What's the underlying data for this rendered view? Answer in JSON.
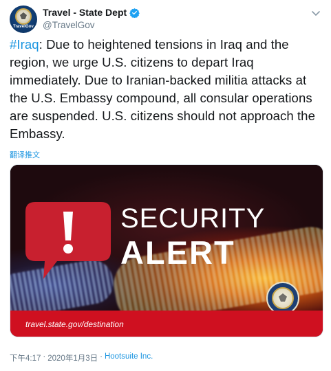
{
  "account": {
    "display_name": "Travel - State Dept",
    "handle": "@TravelGov",
    "avatar_caption": "TravelGov",
    "verified": true
  },
  "tweet": {
    "hashtag": "#Iraq",
    "text": ": Due to heightened tensions in Iraq and the region, we urge U.S. citizens to depart Iraq immediately. Due to Iranian-backed militia attacks at the U.S. Embassy compound, all consular operations are suspended. U.S. citizens should not approach the Embassy.",
    "translate_label": "翻译推文"
  },
  "media": {
    "line1": "SECURITY",
    "line2": "ALERT",
    "url": "travel.state.gov/destination",
    "colors": {
      "band": "#cf1020",
      "bubble": "#c8202f"
    }
  },
  "meta": {
    "time": "下午4:17",
    "separator": "·",
    "date": "2020年1月3日",
    "source": "Hootsuite Inc."
  },
  "icons": [
    "verified-badge-icon",
    "chevron-down-icon",
    "alert-exclamation-icon",
    "state-dept-seal-icon"
  ],
  "colors": {
    "link": "#1b95e0",
    "secondary_text": "#657786"
  }
}
